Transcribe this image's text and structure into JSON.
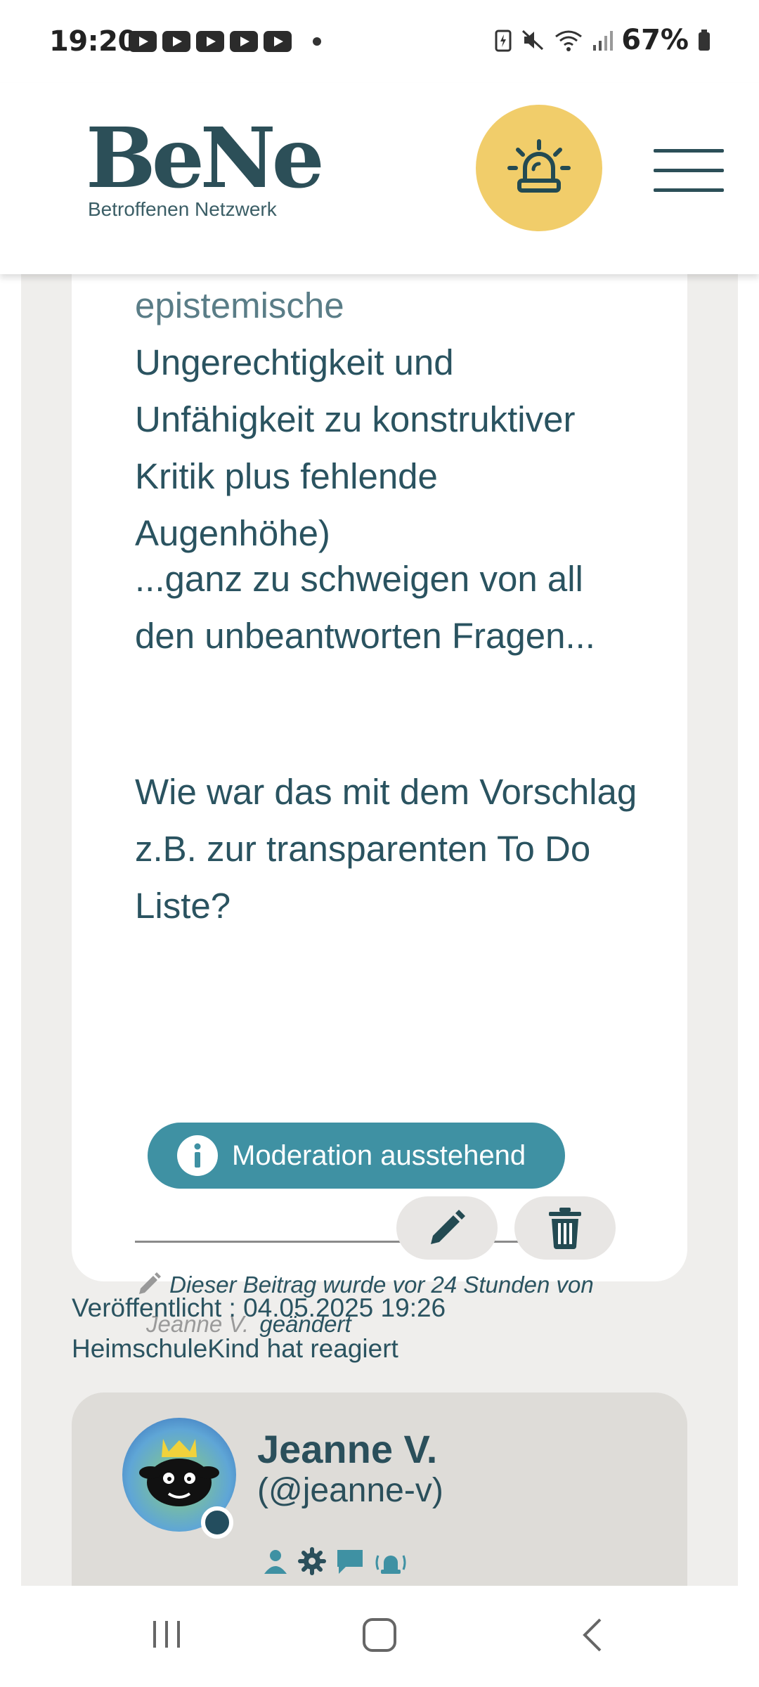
{
  "status_bar": {
    "time": "19:20",
    "battery_percent": "67%",
    "notification_icons": [
      "youtube-icon",
      "flow-icon",
      "youtube-icon",
      "youtube-icon",
      "youtube-icon"
    ]
  },
  "header": {
    "logo_title": "BeNe",
    "logo_subtitle": "Betroffenen Netzwerk",
    "alarm_icon": "alarm-light-icon",
    "menu_icon": "hamburger-menu-icon"
  },
  "post": {
    "text_line_faded": "epistemische",
    "text_block_1": "Ungerechtigkeit und Unfähigkeit zu konstruktiver Kritik plus fehlende Augenhöhe)",
    "text_block_2": "...ganz zu schweigen von all den unbeantworten Fragen...",
    "text_block_3": "Wie war das mit dem Vorschlag z.B. zur transparenten To Do Liste?",
    "edit_note_prefix": "Dieser Beitrag wurde vor 24 Stunden von",
    "edit_note_author": "Jeanne V.",
    "edit_note_suffix": "geändert",
    "moderation_label": "Moderation ausstehend",
    "published": "Veröffentlicht : 04.05.2025 19:26",
    "reaction": "HeimschuleKind hat reagiert"
  },
  "author": {
    "name": "Jeanne V.",
    "handle": "(@jeanne-v)",
    "role_icons": [
      "user-icon",
      "gear-icon",
      "chat-icon",
      "alarm-icon"
    ]
  },
  "colors": {
    "accent": "#3f91a3",
    "text": "#2a5360",
    "alarm_button": "#f1cd6a",
    "author_card": "#dedcd8"
  }
}
